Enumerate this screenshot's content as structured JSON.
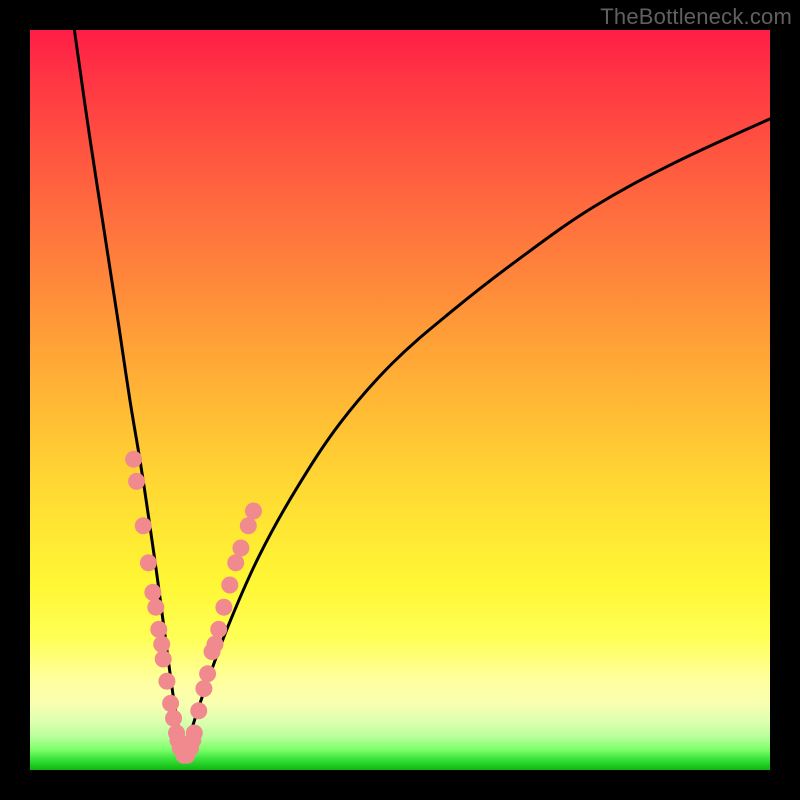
{
  "watermark": {
    "text": "TheBottleneck.com"
  },
  "colors": {
    "curve_stroke": "#000000",
    "marker_fill": "#f08a8e",
    "marker_stroke": "#d66a70",
    "frame": "#000000"
  },
  "chart_data": {
    "type": "line",
    "title": "",
    "xlabel": "",
    "ylabel": "",
    "xlim": [
      0,
      100
    ],
    "ylim": [
      0,
      100
    ],
    "grid": false,
    "legend": false,
    "x_notch": 20,
    "curve_left": {
      "x": [
        6,
        8,
        10,
        12,
        13.5,
        15,
        16.2,
        17.2,
        18,
        18.8,
        19.5,
        20.2,
        20.8
      ],
      "y": [
        100,
        86,
        73,
        60,
        50,
        41,
        33,
        26,
        20,
        14,
        9,
        5,
        2
      ]
    },
    "curve_right": {
      "x": [
        20.8,
        22,
        24,
        27,
        31,
        36,
        42,
        49,
        57,
        66,
        76,
        87,
        100
      ],
      "y": [
        2,
        6,
        12,
        20,
        29,
        38,
        47,
        55,
        62,
        69,
        76,
        82,
        88
      ]
    },
    "markers": [
      {
        "x": 14.0,
        "y": 42
      },
      {
        "x": 14.4,
        "y": 39
      },
      {
        "x": 15.3,
        "y": 33
      },
      {
        "x": 16.0,
        "y": 28
      },
      {
        "x": 16.6,
        "y": 24
      },
      {
        "x": 17.0,
        "y": 22
      },
      {
        "x": 17.4,
        "y": 19
      },
      {
        "x": 17.8,
        "y": 17
      },
      {
        "x": 18.0,
        "y": 15
      },
      {
        "x": 18.5,
        "y": 12
      },
      {
        "x": 19.0,
        "y": 9
      },
      {
        "x": 19.4,
        "y": 7
      },
      {
        "x": 19.8,
        "y": 5
      },
      {
        "x": 20.0,
        "y": 4
      },
      {
        "x": 20.3,
        "y": 3
      },
      {
        "x": 20.8,
        "y": 2
      },
      {
        "x": 21.2,
        "y": 2
      },
      {
        "x": 21.7,
        "y": 3
      },
      {
        "x": 22.0,
        "y": 4
      },
      {
        "x": 22.2,
        "y": 5
      },
      {
        "x": 22.8,
        "y": 8
      },
      {
        "x": 23.5,
        "y": 11
      },
      {
        "x": 24.0,
        "y": 13
      },
      {
        "x": 24.6,
        "y": 16
      },
      {
        "x": 25.0,
        "y": 17
      },
      {
        "x": 25.5,
        "y": 19
      },
      {
        "x": 26.2,
        "y": 22
      },
      {
        "x": 27.0,
        "y": 25
      },
      {
        "x": 27.8,
        "y": 28
      },
      {
        "x": 28.5,
        "y": 30
      },
      {
        "x": 29.5,
        "y": 33
      },
      {
        "x": 30.2,
        "y": 35
      }
    ]
  }
}
